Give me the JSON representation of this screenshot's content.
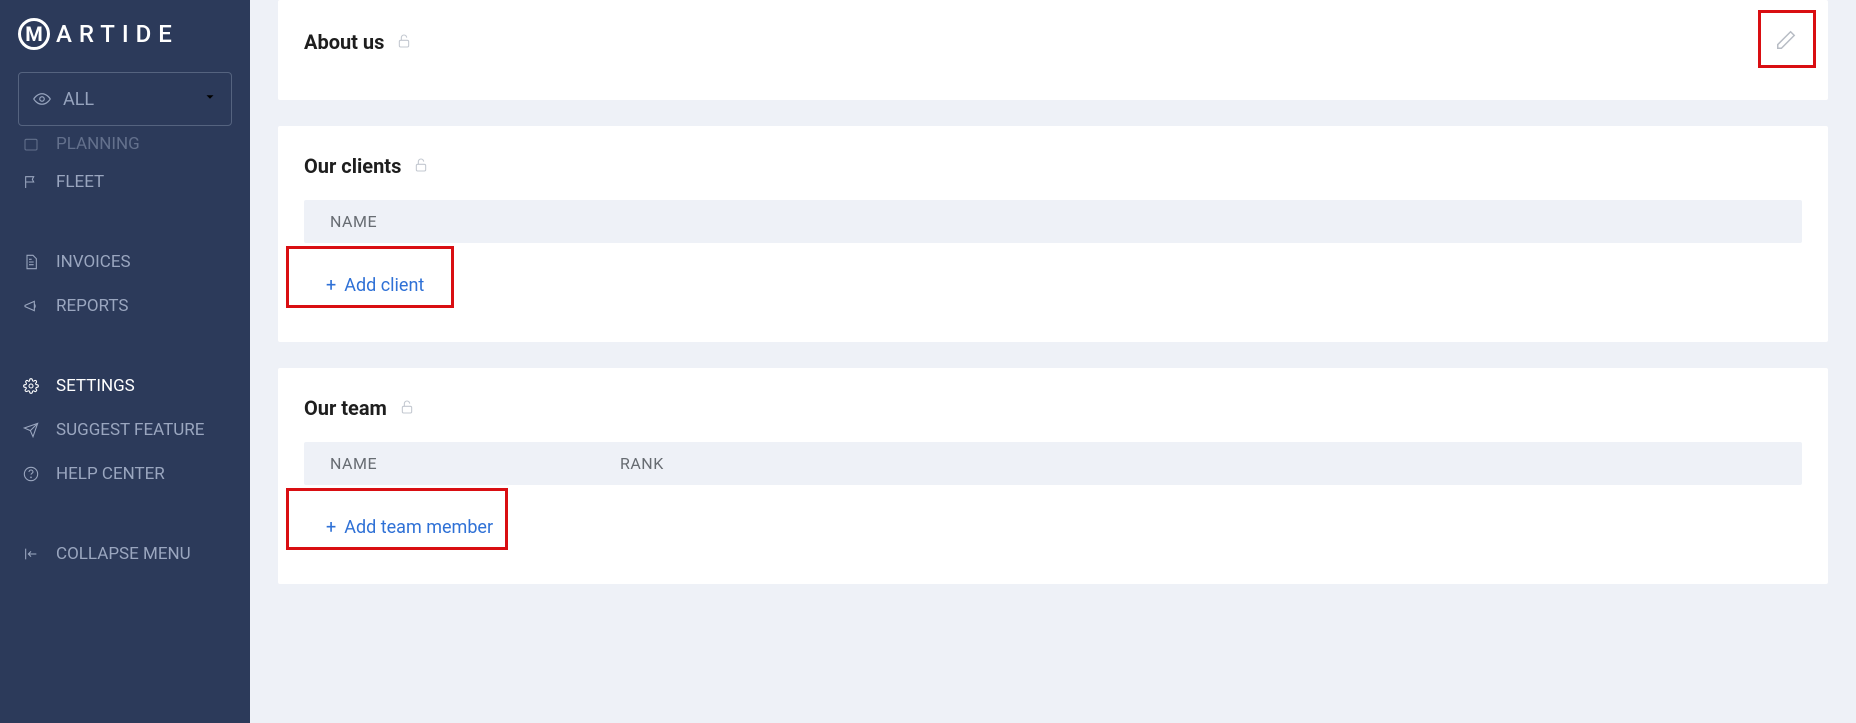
{
  "logo_text": "ARTIDE",
  "filter": {
    "label": "ALL"
  },
  "nav": {
    "planning": "PLANNING",
    "fleet": "FLEET",
    "invoices": "INVOICES",
    "reports": "REPORTS",
    "settings": "SETTINGS",
    "suggest": "SUGGEST FEATURE",
    "help": "HELP CENTER",
    "collapse": "COLLAPSE MENU"
  },
  "about": {
    "title": "About us"
  },
  "clients": {
    "title": "Our clients",
    "col_name": "NAME",
    "add_label": "Add client"
  },
  "team": {
    "title": "Our team",
    "col_name": "NAME",
    "col_rank": "RANK",
    "add_label": "Add team member"
  }
}
